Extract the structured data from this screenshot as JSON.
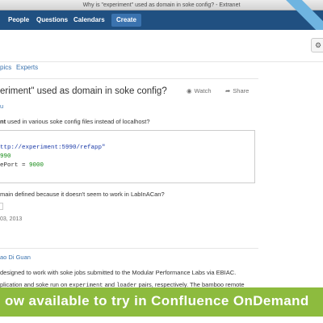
{
  "window": {
    "title": "Why is \"experiment\" used as domain in soke config? - Extranet"
  },
  "nav": {
    "items": [
      "People",
      "Questions",
      "Calendars"
    ],
    "create_label": "Create"
  },
  "toolbar": {
    "settings_icon": "gear-icon"
  },
  "subnav": {
    "topics_label": "pics",
    "experts_label": "Experts"
  },
  "question": {
    "title": "eriment\" used as domain in soke config?",
    "watch_label": "Watch",
    "share_label": "Share",
    "author": "u",
    "body_line1_bold": "nt",
    "body_line1_rest": " used in various soke config files instead of localhost?",
    "code": {
      "line1": "ttp://experiment:5990/refapp\"",
      "line2": "990",
      "line3_key": "ePort = ",
      "line3_val": "9000"
    },
    "body_line2": "main defined because it doesn't seem to work in LabInACan?",
    "date": "03, 2013"
  },
  "answer": {
    "author": "ao Di Guan",
    "line1": "designed to work with soke jobs submitted to the Modular Performance Labs via EBIAC.",
    "line2_a": "plication and soke run on ",
    "line2_code1": "experiment",
    "line2_b": " and ",
    "line2_code2": "loader",
    "line2_c": " pairs, respectively. The bamboo remote"
  },
  "banner": {
    "text": "ow available to try in Confluence OnDemand"
  },
  "colors": {
    "nav_bg": "#205081",
    "link": "#3b73af",
    "banner_bg": "#8dbb3e",
    "code_string": "#1a3aa8",
    "code_number": "#118811"
  }
}
